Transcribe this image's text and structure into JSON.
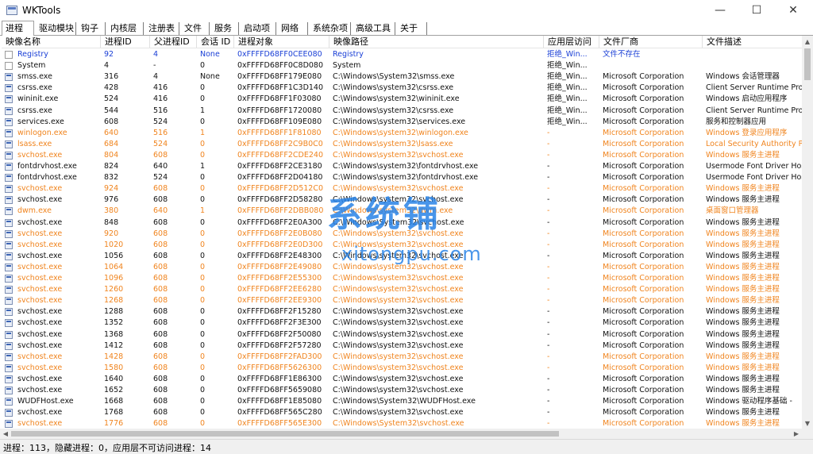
{
  "window": {
    "title": "WKTools",
    "min_icon": "minimize-icon",
    "max_icon": "maximize-icon",
    "close_icon": "close-icon",
    "min": "—",
    "max": "☐",
    "close": "✕"
  },
  "tabs": [
    "进程",
    "驱动模块",
    "钩子",
    "内核层",
    "注册表",
    "文件",
    "服务",
    "启动项",
    "网络",
    "系统杂项",
    "高级工具",
    "关于"
  ],
  "columns": [
    "映像名称",
    "进程ID",
    "父进程ID",
    "会话 ID",
    "进程对象",
    "映像路径",
    "应用层访问",
    "文件厂商",
    "文件描述"
  ],
  "colors": {
    "system": "#1a3fd6",
    "unsigned": "#f0841e",
    "normal": "#111111",
    "watermark": "#2882e6"
  },
  "rows": [
    {
      "name": "Registry",
      "pid": "92",
      "ppid": "4",
      "session": "None",
      "obj": "0xFFFFD68FF0CEE080",
      "path": "Registry",
      "access": "拒绝_Win...",
      "vendor": "文件不存在",
      "desc": "",
      "color": "blue",
      "icon": "doc"
    },
    {
      "name": "System",
      "pid": "4",
      "ppid": "-",
      "session": "0",
      "obj": "0xFFFFD68FF0C8D080",
      "path": "System",
      "access": "拒绝_Win...",
      "vendor": "",
      "desc": "",
      "color": "black",
      "icon": "doc"
    },
    {
      "name": "smss.exe",
      "pid": "316",
      "ppid": "4",
      "session": "None",
      "obj": "0xFFFFD68FF179E080",
      "path": "C:\\Windows\\System32\\smss.exe",
      "access": "拒绝_Win...",
      "vendor": "Microsoft Corporation",
      "desc": "Windows 会话管理器",
      "color": "black",
      "icon": "win"
    },
    {
      "name": "csrss.exe",
      "pid": "428",
      "ppid": "416",
      "session": "0",
      "obj": "0xFFFFD68FF1C3D140",
      "path": "C:\\Windows\\system32\\csrss.exe",
      "access": "拒绝_Win...",
      "vendor": "Microsoft Corporation",
      "desc": "Client Server Runtime Pro",
      "color": "black",
      "icon": "win"
    },
    {
      "name": "wininit.exe",
      "pid": "524",
      "ppid": "416",
      "session": "0",
      "obj": "0xFFFFD68FF1F03080",
      "path": "C:\\Windows\\system32\\wininit.exe",
      "access": "拒绝_Win...",
      "vendor": "Microsoft Corporation",
      "desc": "Windows 启动应用程序",
      "color": "black",
      "icon": "win"
    },
    {
      "name": "csrss.exe",
      "pid": "544",
      "ppid": "516",
      "session": "1",
      "obj": "0xFFFFD68FF1720080",
      "path": "C:\\Windows\\system32\\csrss.exe",
      "access": "拒绝_Win...",
      "vendor": "Microsoft Corporation",
      "desc": "Client Server Runtime Pro",
      "color": "black",
      "icon": "win"
    },
    {
      "name": "services.exe",
      "pid": "608",
      "ppid": "524",
      "session": "0",
      "obj": "0xFFFFD68FF109E080",
      "path": "C:\\Windows\\system32\\services.exe",
      "access": "拒绝_Win...",
      "vendor": "Microsoft Corporation",
      "desc": "服务和控制器应用",
      "color": "black",
      "icon": "win"
    },
    {
      "name": "winlogon.exe",
      "pid": "640",
      "ppid": "516",
      "session": "1",
      "obj": "0xFFFFD68FF1F81080",
      "path": "C:\\Windows\\system32\\winlogon.exe",
      "access": "-",
      "vendor": "Microsoft Corporation",
      "desc": "Windows 登录应用程序",
      "color": "orange",
      "icon": "win"
    },
    {
      "name": "lsass.exe",
      "pid": "684",
      "ppid": "524",
      "session": "0",
      "obj": "0xFFFFD68FF2C9B0C0",
      "path": "C:\\Windows\\system32\\lsass.exe",
      "access": "-",
      "vendor": "Microsoft Corporation",
      "desc": "Local Security Authority P",
      "color": "orange",
      "icon": "win"
    },
    {
      "name": "svchost.exe",
      "pid": "804",
      "ppid": "608",
      "session": "0",
      "obj": "0xFFFFD68FF2CDE240",
      "path": "C:\\Windows\\system32\\svchost.exe",
      "access": "-",
      "vendor": "Microsoft Corporation",
      "desc": "Windows 服务主进程",
      "color": "orange",
      "icon": "win"
    },
    {
      "name": "fontdrvhost.exe",
      "pid": "824",
      "ppid": "640",
      "session": "1",
      "obj": "0xFFFFD68FF2CE3180",
      "path": "C:\\Windows\\system32\\fontdrvhost.exe",
      "access": "-",
      "vendor": "Microsoft Corporation",
      "desc": "Usermode Font Driver Hos",
      "color": "black",
      "icon": "win"
    },
    {
      "name": "fontdrvhost.exe",
      "pid": "832",
      "ppid": "524",
      "session": "0",
      "obj": "0xFFFFD68FF2D04180",
      "path": "C:\\Windows\\system32\\fontdrvhost.exe",
      "access": "-",
      "vendor": "Microsoft Corporation",
      "desc": "Usermode Font Driver Hos",
      "color": "black",
      "icon": "win"
    },
    {
      "name": "svchost.exe",
      "pid": "924",
      "ppid": "608",
      "session": "0",
      "obj": "0xFFFFD68FF2D512C0",
      "path": "C:\\Windows\\system32\\svchost.exe",
      "access": "-",
      "vendor": "Microsoft Corporation",
      "desc": "Windows 服务主进程",
      "color": "orange",
      "icon": "win"
    },
    {
      "name": "svchost.exe",
      "pid": "976",
      "ppid": "608",
      "session": "0",
      "obj": "0xFFFFD68FF2D58280",
      "path": "C:\\Windows\\system32\\svchost.exe",
      "access": "-",
      "vendor": "Microsoft Corporation",
      "desc": "Windows 服务主进程",
      "color": "black",
      "icon": "win"
    },
    {
      "name": "dwm.exe",
      "pid": "380",
      "ppid": "640",
      "session": "1",
      "obj": "0xFFFFD68FF2DBB080",
      "path": "C:\\Windows\\system32\\dwm.exe",
      "access": "-",
      "vendor": "Microsoft Corporation",
      "desc": "桌面窗口管理器",
      "color": "orange",
      "icon": "win"
    },
    {
      "name": "svchost.exe",
      "pid": "848",
      "ppid": "608",
      "session": "0",
      "obj": "0xFFFFD68FF2E0A300",
      "path": "C:\\Windows\\System32\\svchost.exe",
      "access": "-",
      "vendor": "Microsoft Corporation",
      "desc": "Windows 服务主进程",
      "color": "black",
      "icon": "win"
    },
    {
      "name": "svchost.exe",
      "pid": "920",
      "ppid": "608",
      "session": "0",
      "obj": "0xFFFFD68FF2E0B080",
      "path": "C:\\Windows\\system32\\svchost.exe",
      "access": "-",
      "vendor": "Microsoft Corporation",
      "desc": "Windows 服务主进程",
      "color": "orange",
      "icon": "win"
    },
    {
      "name": "svchost.exe",
      "pid": "1020",
      "ppid": "608",
      "session": "0",
      "obj": "0xFFFFD68FF2E0D300",
      "path": "C:\\Windows\\system32\\svchost.exe",
      "access": "-",
      "vendor": "Microsoft Corporation",
      "desc": "Windows 服务主进程",
      "color": "orange",
      "icon": "win"
    },
    {
      "name": "svchost.exe",
      "pid": "1056",
      "ppid": "608",
      "session": "0",
      "obj": "0xFFFFD68FF2E48300",
      "path": "C:\\Windows\\system32\\svchost.exe",
      "access": "-",
      "vendor": "Microsoft Corporation",
      "desc": "Windows 服务主进程",
      "color": "black",
      "icon": "win"
    },
    {
      "name": "svchost.exe",
      "pid": "1064",
      "ppid": "608",
      "session": "0",
      "obj": "0xFFFFD68FF2E49080",
      "path": "C:\\Windows\\system32\\svchost.exe",
      "access": "-",
      "vendor": "Microsoft Corporation",
      "desc": "Windows 服务主进程",
      "color": "orange",
      "icon": "win"
    },
    {
      "name": "svchost.exe",
      "pid": "1096",
      "ppid": "608",
      "session": "0",
      "obj": "0xFFFFD68FF2E55300",
      "path": "C:\\Windows\\system32\\svchost.exe",
      "access": "-",
      "vendor": "Microsoft Corporation",
      "desc": "Windows 服务主进程",
      "color": "orange",
      "icon": "win"
    },
    {
      "name": "svchost.exe",
      "pid": "1260",
      "ppid": "608",
      "session": "0",
      "obj": "0xFFFFD68FF2EE6280",
      "path": "C:\\Windows\\system32\\svchost.exe",
      "access": "-",
      "vendor": "Microsoft Corporation",
      "desc": "Windows 服务主进程",
      "color": "orange",
      "icon": "win"
    },
    {
      "name": "svchost.exe",
      "pid": "1268",
      "ppid": "608",
      "session": "0",
      "obj": "0xFFFFD68FF2EE9300",
      "path": "C:\\Windows\\system32\\svchost.exe",
      "access": "-",
      "vendor": "Microsoft Corporation",
      "desc": "Windows 服务主进程",
      "color": "orange",
      "icon": "win"
    },
    {
      "name": "svchost.exe",
      "pid": "1288",
      "ppid": "608",
      "session": "0",
      "obj": "0xFFFFD68FF2F15280",
      "path": "C:\\Windows\\system32\\svchost.exe",
      "access": "-",
      "vendor": "Microsoft Corporation",
      "desc": "Windows 服务主进程",
      "color": "black",
      "icon": "win"
    },
    {
      "name": "svchost.exe",
      "pid": "1352",
      "ppid": "608",
      "session": "0",
      "obj": "0xFFFFD68FF2F3E300",
      "path": "C:\\Windows\\system32\\svchost.exe",
      "access": "-",
      "vendor": "Microsoft Corporation",
      "desc": "Windows 服务主进程",
      "color": "black",
      "icon": "win"
    },
    {
      "name": "svchost.exe",
      "pid": "1368",
      "ppid": "608",
      "session": "0",
      "obj": "0xFFFFD68FF2F50080",
      "path": "C:\\Windows\\system32\\svchost.exe",
      "access": "-",
      "vendor": "Microsoft Corporation",
      "desc": "Windows 服务主进程",
      "color": "black",
      "icon": "win"
    },
    {
      "name": "svchost.exe",
      "pid": "1412",
      "ppid": "608",
      "session": "0",
      "obj": "0xFFFFD68FF2F57280",
      "path": "C:\\Windows\\system32\\svchost.exe",
      "access": "-",
      "vendor": "Microsoft Corporation",
      "desc": "Windows 服务主进程",
      "color": "black",
      "icon": "win"
    },
    {
      "name": "svchost.exe",
      "pid": "1428",
      "ppid": "608",
      "session": "0",
      "obj": "0xFFFFD68FF2FAD300",
      "path": "C:\\Windows\\system32\\svchost.exe",
      "access": "-",
      "vendor": "Microsoft Corporation",
      "desc": "Windows 服务主进程",
      "color": "orange",
      "icon": "win"
    },
    {
      "name": "svchost.exe",
      "pid": "1580",
      "ppid": "608",
      "session": "0",
      "obj": "0xFFFFD68FF5626300",
      "path": "C:\\Windows\\system32\\svchost.exe",
      "access": "-",
      "vendor": "Microsoft Corporation",
      "desc": "Windows 服务主进程",
      "color": "orange",
      "icon": "win"
    },
    {
      "name": "svchost.exe",
      "pid": "1640",
      "ppid": "608",
      "session": "0",
      "obj": "0xFFFFD68FF1E86300",
      "path": "C:\\Windows\\system32\\svchost.exe",
      "access": "-",
      "vendor": "Microsoft Corporation",
      "desc": "Windows 服务主进程",
      "color": "black",
      "icon": "win"
    },
    {
      "name": "svchost.exe",
      "pid": "1652",
      "ppid": "608",
      "session": "0",
      "obj": "0xFFFFD68FF5659080",
      "path": "C:\\Windows\\system32\\svchost.exe",
      "access": "-",
      "vendor": "Microsoft Corporation",
      "desc": "Windows 服务主进程",
      "color": "black",
      "icon": "win"
    },
    {
      "name": "WUDFHost.exe",
      "pid": "1668",
      "ppid": "608",
      "session": "0",
      "obj": "0xFFFFD68FF1E85080",
      "path": "C:\\Windows\\System32\\WUDFHost.exe",
      "access": "-",
      "vendor": "Microsoft Corporation",
      "desc": "Windows 驱动程序基础 -",
      "color": "black",
      "icon": "win"
    },
    {
      "name": "svchost.exe",
      "pid": "1768",
      "ppid": "608",
      "session": "0",
      "obj": "0xFFFFD68FF565C280",
      "path": "C:\\Windows\\system32\\svchost.exe",
      "access": "-",
      "vendor": "Microsoft Corporation",
      "desc": "Windows 服务主进程",
      "color": "black",
      "icon": "win"
    },
    {
      "name": "svchost.exe",
      "pid": "1776",
      "ppid": "608",
      "session": "0",
      "obj": "0xFFFFD68FF565E300",
      "path": "C:\\Windows\\System32\\svchost.exe",
      "access": "-",
      "vendor": "Microsoft Corporation",
      "desc": "Windows 服务主进程",
      "color": "orange",
      "icon": "win"
    }
  ],
  "status_text": "进程：113，隐藏进程：0，应用层不可访问进程：14",
  "watermark": {
    "big": "系统铺",
    "small": "xitongpu.com"
  },
  "scroll": {
    "up": "▲",
    "down": "▼",
    "left": "◀",
    "right": "▶"
  }
}
